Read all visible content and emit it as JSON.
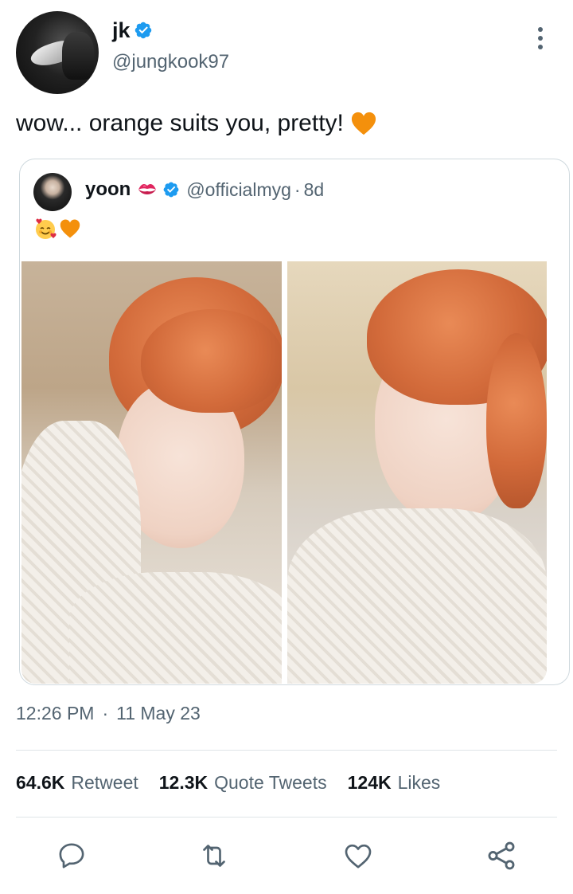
{
  "author": {
    "display_name": "jk",
    "handle": "@jungkook97",
    "verified": true
  },
  "tweet": {
    "text": "wow... orange suits you, pretty!",
    "trailing_emoji": "orange-heart"
  },
  "quoted_tweet": {
    "display_name": "yoon",
    "name_emoji": "kiss-mark",
    "verified": true,
    "handle": "@officialmyg",
    "separator": "·",
    "time": "8d",
    "emojis": [
      "smiling-face-with-hearts",
      "orange-heart"
    ],
    "photos": [
      "photo-left",
      "photo-right"
    ]
  },
  "meta": {
    "time": "12:26 PM",
    "separator": "·",
    "date": "11 May 23"
  },
  "stats": [
    {
      "value": "64.6K",
      "label": "Retweet"
    },
    {
      "value": "12.3K",
      "label": "Quote Tweets"
    },
    {
      "value": "124K",
      "label": "Likes"
    }
  ],
  "actions": [
    "reply-icon",
    "retweet-icon",
    "like-icon",
    "share-icon"
  ],
  "colors": {
    "verified": "#1d9bf0",
    "secondary_text": "#536471",
    "primary_text": "#0f1419",
    "border": "#cfd9de",
    "orange_heart": "#f4900c"
  }
}
